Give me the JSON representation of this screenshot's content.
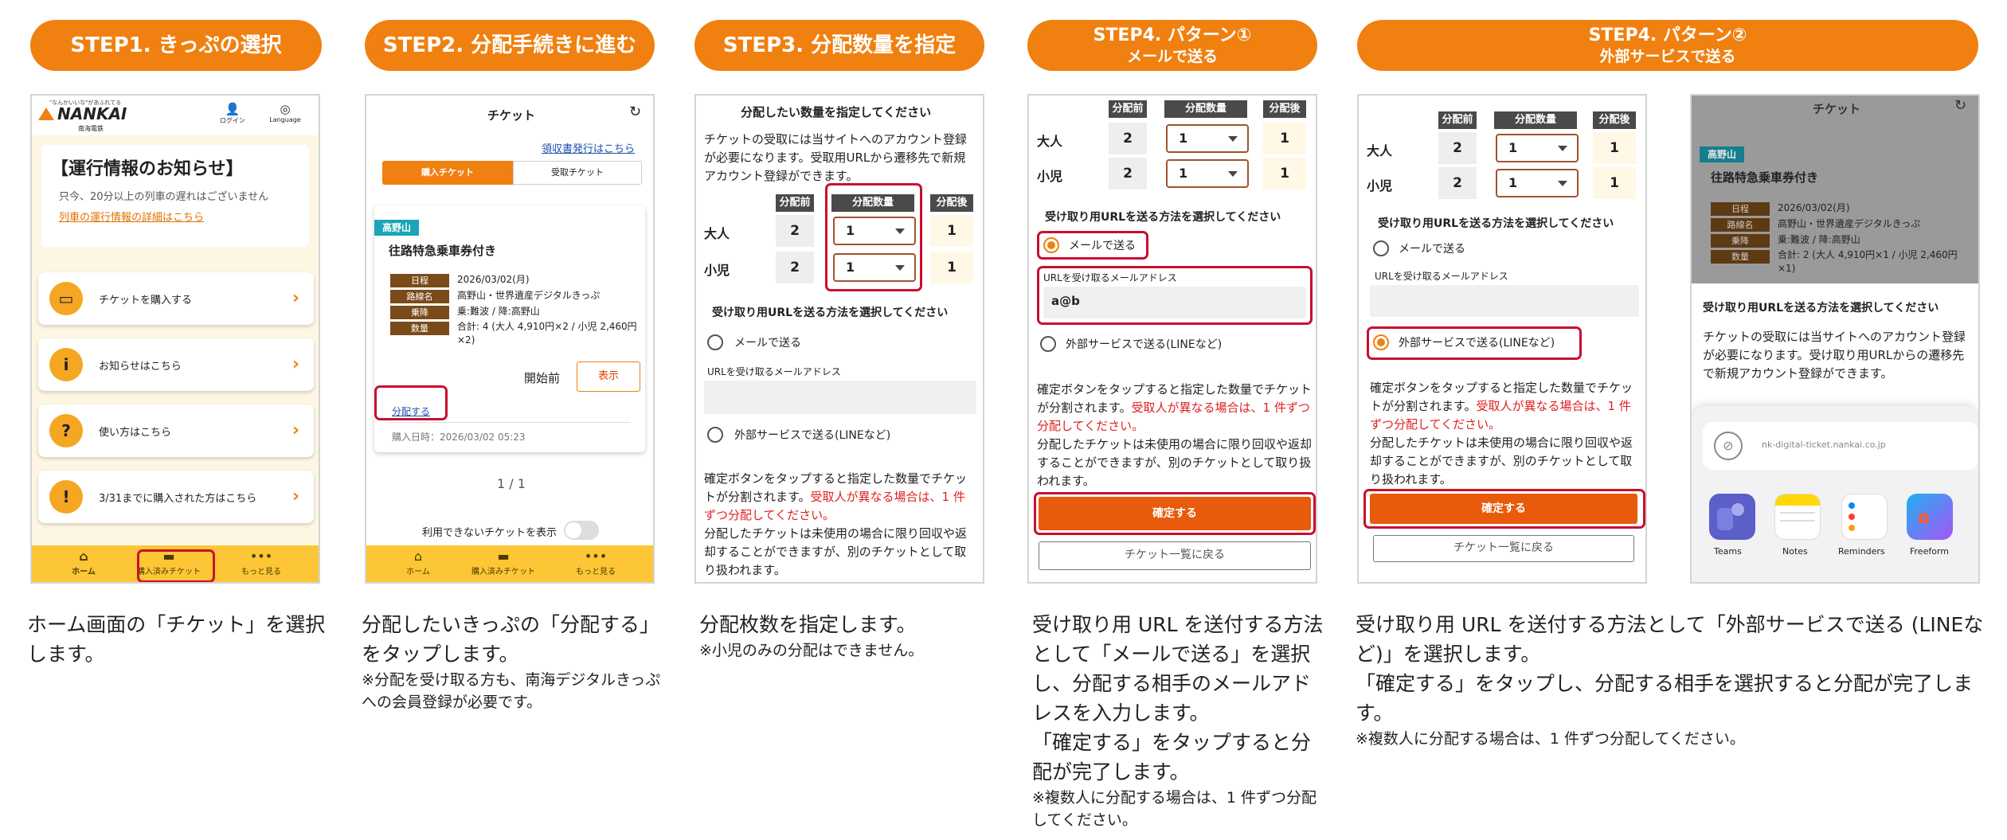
{
  "steps": {
    "s1": "STEP1. きっぷの選択",
    "s2": "STEP2. 分配手続きに進む",
    "s3": "STEP3. 分配数量を指定",
    "s4a_l1": "STEP4. パターン①",
    "s4a_l2": "メールで送る",
    "s4b_l1": "STEP4. パターン②",
    "s4b_l2": "外部サービスで送る"
  },
  "desc": {
    "d1": "ホーム画面の「チケット」を選択します。",
    "d2": "分配したいきっぷの「分配する」をタップします。",
    "d2n": "※分配を受け取る方も、南海デジタルきっぷへの会員登録が必要です。",
    "d3": "分配枚数を指定します。",
    "d3n": "※小児のみの分配はできません。",
    "d4": "受け取り用 URL を送付する方法として「メールで送る」を選択し、分配する相手のメールアドレスを入力します。",
    "d4b": "「確定する」をタップすると分配が完了します。",
    "d4n": "※複数人に分配する場合は、1 件ずつ分配してください。",
    "d5": "受け取り用 URL を送付する方法として「外部サービスで送る (LINEなど)」を選択します。",
    "d5b": "「確定する」をタップし、分配する相手を選択すると分配が完了します。",
    "d5n": "※複数人に分配する場合は、1 件ずつ分配してください。"
  },
  "home": {
    "logo_tag": "\"なんかいいな\"があふれてる",
    "logo": "NANKAI",
    "logo_sub": "南海電鉄",
    "login": "ログイン",
    "language": "Language",
    "notice_title": "【運行情報のお知らせ】",
    "notice_body": "只今、20分以上の列車の遅れはございません",
    "notice_link": "列車の運行情報の詳細はこちら",
    "menu": [
      "チケットを購入する",
      "お知らせはこちら",
      "使い方はこちら",
      "3/31までに購入された方はこちら"
    ],
    "nav": [
      "ホーム",
      "購入済みチケット",
      "もっと見る"
    ]
  },
  "ticket": {
    "title": "チケット",
    "receipt": "領収書発行はこちら",
    "tab_bought": "購入チケット",
    "tab_recv": "受取チケット",
    "area": "高野山",
    "name": "往路特急乗車券付き",
    "labels": [
      "日程",
      "路線名",
      "乗降",
      "数量"
    ],
    "date": "2026/03/02(月)",
    "route": "高野山・世界遺産デジタルきっぷ",
    "board": "乗:難波 / 降:高野山",
    "qty": "合計: 4 (大人 4,910円×2 / 小児 2,460円×2)",
    "status": "開始前",
    "show": "表示",
    "split": "分配する",
    "purchased": "購入日時：2026/03/02 05:23",
    "page": "1 / 1",
    "unavail": "利用できないチケットを表示"
  },
  "qty": {
    "heading": "分配したい数量を指定してください",
    "intro": "チケットの受取には当サイトへのアカウント登録が必要になります。受取用URLから遷移先で新規アカウント登録ができます。",
    "col_before": "分配前",
    "col_qty": "分配数量",
    "col_after": "分配後",
    "adult": "大人",
    "child": "小児",
    "before": "2",
    "sel": "1",
    "after": "1",
    "method": "受け取り用URLを送る方法を選択してください",
    "email": "メールで送る",
    "email_label": "URLを受け取るメールアドレス",
    "external": "外部サービスで送る(LINEなど)",
    "confirm_a": "確定ボタンをタップすると指定した数量でチケットが分割されます。",
    "confirm_red": "受取人が異なる場合は、1 件ずつ分配してください。",
    "confirm_b": "分配したチケットは未使用の場合に限り回収や返却することができますが、別のチケットとして取り扱われます。"
  },
  "mail": {
    "value": "a@b",
    "ok": "確定する",
    "back": "チケット一覧に戻る"
  },
  "ext": {
    "confirm_a": "確定ボタンをタップすると指定した数量でチケットが分割されます。",
    "confirm_red": "受取人が異なる場合は、1 件ずつ分配してください。",
    "confirm_b": "分配したチケットは未使用の場合に限り回収や返却することができますが、別のチケットとして取り扱われます。"
  },
  "share": {
    "title": "チケット",
    "area": "高野山",
    "name": "往路特急乗車券付き",
    "date": "2026/03/02(月)",
    "route": "高野山・世界遺産デジタルきっぷ",
    "board": "乗:難波 / 降:高野山",
    "qty": "合計: 2 (大人 4,910円×1 / 小児 2,460円×1)",
    "method": "受け取り用URLを送る方法を選択してください",
    "body": "チケットの受取には当サイトへのアカウント登録が必要になります。受け取り用URLからの遷移先で新規アカウント登録ができます。",
    "url": "nk-digital-ticket.nankai.co.jp",
    "apps": [
      "Teams",
      "Notes",
      "Reminders",
      "Freeform"
    ],
    "colors": {
      "orange": "#f08010",
      "nav": "#fcc636",
      "red_frame": "#c8102e",
      "area_tag": "#1aa5b8",
      "confirm": "#e85a0c"
    }
  }
}
